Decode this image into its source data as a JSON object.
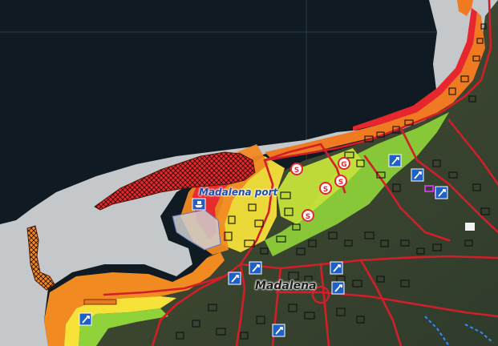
{
  "map": {
    "labels": {
      "port": "Madalena port",
      "town": "Madalena"
    },
    "poi_markers": [
      {
        "type": "school",
        "glyph": "S"
      },
      {
        "type": "school",
        "glyph": "S"
      },
      {
        "type": "school",
        "glyph": "S"
      },
      {
        "type": "school",
        "glyph": "S"
      },
      {
        "type": "gas-station",
        "glyph": "G"
      }
    ],
    "colors": {
      "ocean": "#0f1a22",
      "surf": "#c9ccd0",
      "hazard_high": "#e8262d",
      "hazard_mid": "#f28a22",
      "hazard_low": "#f7e23a",
      "hazard_min": "#8fd23a",
      "roads": "#d11f2a",
      "buildings": "#111111",
      "marker_blue": "#1f5fc8",
      "flood_zone_outline": "#7a2a10",
      "boundary_dashed": "#2f8cff"
    }
  }
}
